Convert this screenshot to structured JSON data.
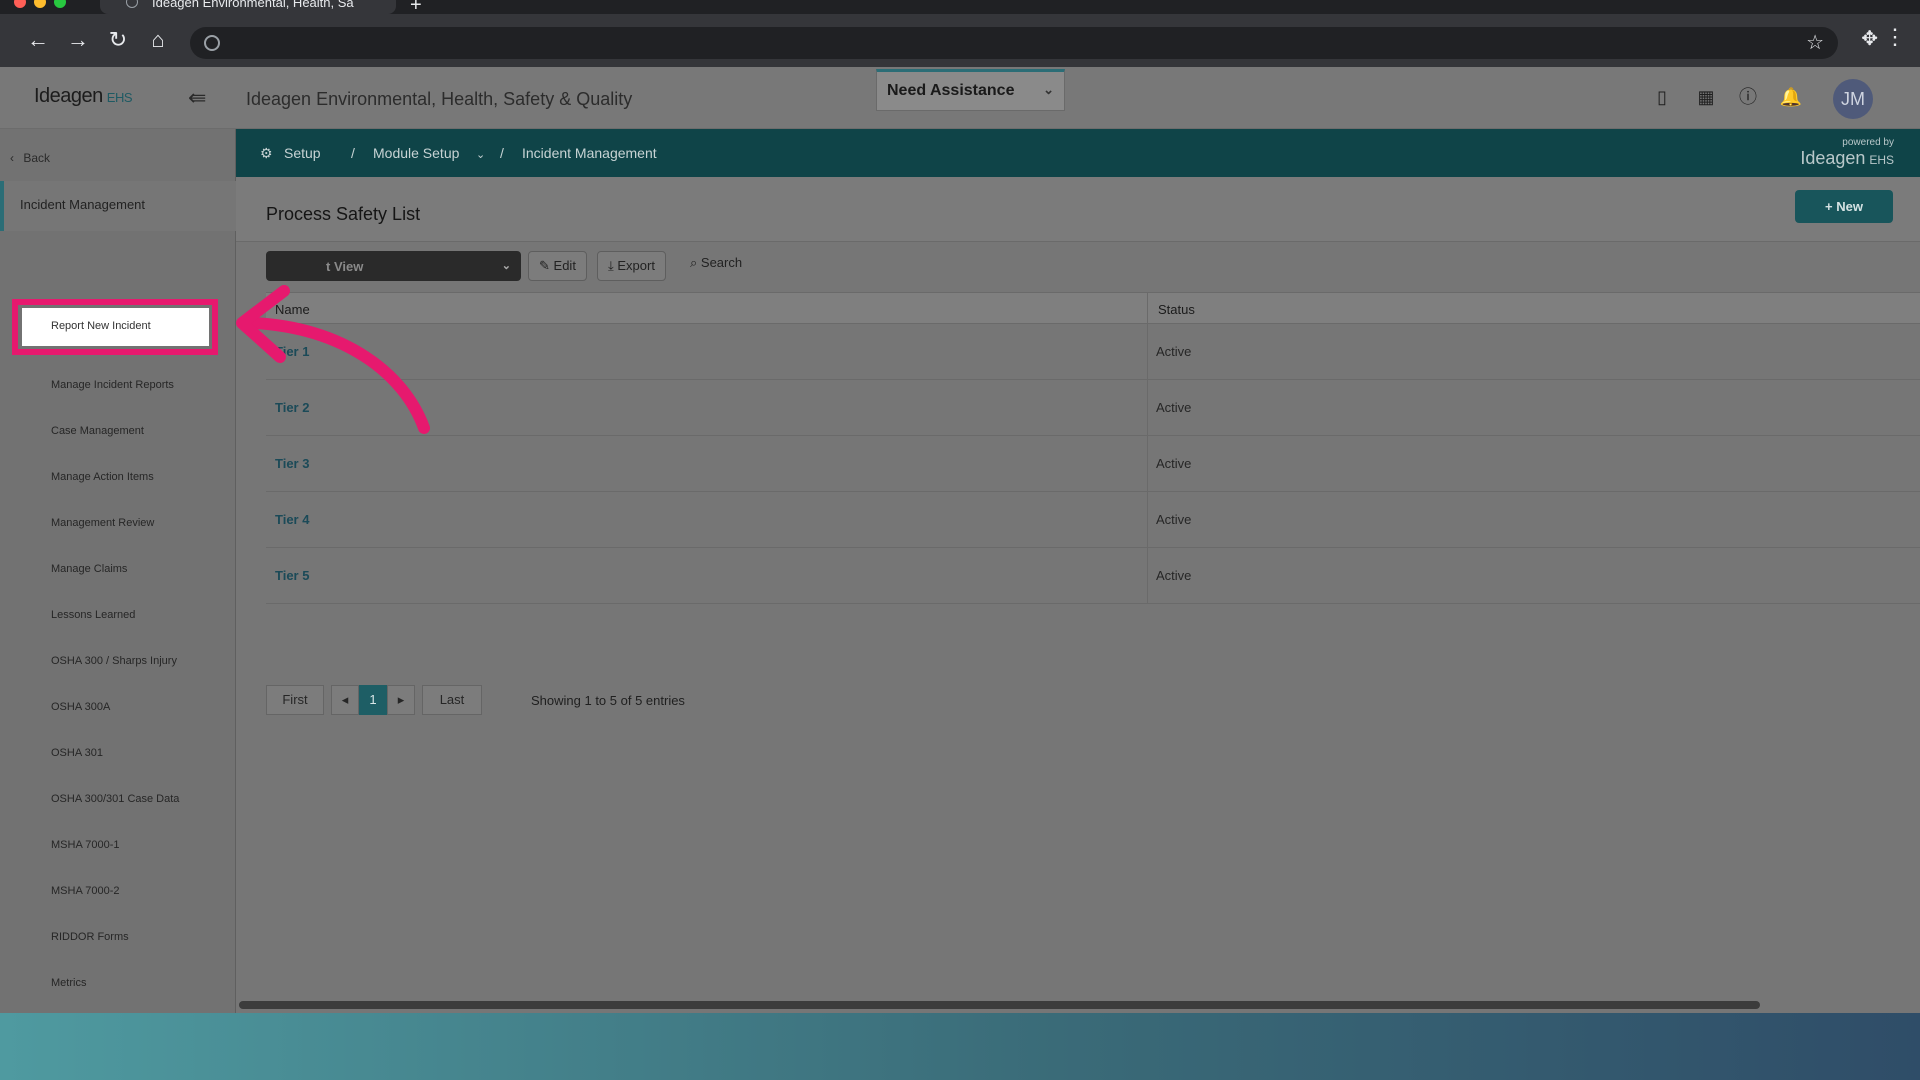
{
  "browser": {
    "tab_title": "Ideagen Environmental, Health, Sa"
  },
  "header": {
    "logo_text": "Ideagen",
    "logo_suffix": "EHS",
    "app_title": "Ideagen Environmental, Health, Safety & Quality",
    "assist_label": "Need Assistance",
    "avatar_initials": "JM"
  },
  "sidebar": {
    "back_label": "Back",
    "section_label": "Incident Management",
    "items": [
      {
        "label": "Report New Incident"
      },
      {
        "label": "Manage Incident Reports"
      },
      {
        "label": "Case Management"
      },
      {
        "label": "Manage Action Items"
      },
      {
        "label": "Management Review"
      },
      {
        "label": "Manage Claims"
      },
      {
        "label": "Lessons Learned"
      },
      {
        "label": "OSHA 300 / Sharps Injury"
      },
      {
        "label": "OSHA 300A"
      },
      {
        "label": "OSHA 301"
      },
      {
        "label": "OSHA 300/301 Case Data"
      },
      {
        "label": "MSHA 7000-1"
      },
      {
        "label": "MSHA 7000-2"
      },
      {
        "label": "RIDDOR Forms"
      },
      {
        "label": "Metrics"
      }
    ]
  },
  "breadcrumb": {
    "setup": "Setup",
    "module_setup": "Module Setup",
    "current": "Incident Management",
    "separator": "/",
    "powered_by": "powered by",
    "brand": "Ideagen",
    "brand_suffix": "EHS"
  },
  "main": {
    "title": "Process Safety List",
    "new_button": "New",
    "view_label": "t View",
    "edit_button": "Edit",
    "export_button": "Export",
    "search_label": "Search",
    "columns": [
      "Name",
      "Status"
    ],
    "rows": [
      {
        "name": "Tier 1",
        "status": "Active"
      },
      {
        "name": "Tier 2",
        "status": "Active"
      },
      {
        "name": "Tier 3",
        "status": "Active"
      },
      {
        "name": "Tier 4",
        "status": "Active"
      },
      {
        "name": "Tier 5",
        "status": "Active"
      }
    ],
    "pager": {
      "first": "First",
      "page": "1",
      "last": "Last",
      "showing": "Showing 1 to 5 of 5 entries"
    }
  },
  "colors": {
    "accent": "#0f4448",
    "highlight": "#e6196e",
    "link": "#1b4a58"
  }
}
